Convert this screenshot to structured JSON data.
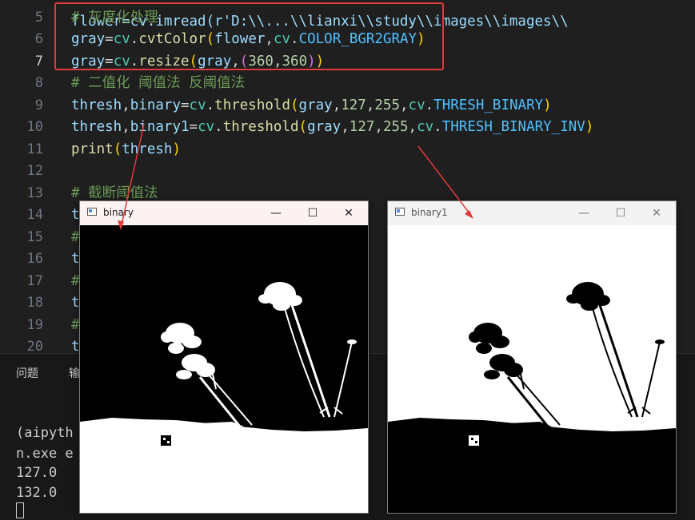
{
  "editor": {
    "lines": [
      {
        "n": "5",
        "active": false,
        "tokens": [
          {
            "t": "# 灰度化处理",
            "c": "comment"
          }
        ]
      },
      {
        "n": "6",
        "active": false,
        "tokens": [
          {
            "t": "gray",
            "c": "var"
          },
          {
            "t": "=",
            "c": "op"
          },
          {
            "t": "cv",
            "c": "mod"
          },
          {
            "t": ".",
            "c": "op"
          },
          {
            "t": "cvtColor",
            "c": "fn"
          },
          {
            "t": "(",
            "c": "p1"
          },
          {
            "t": "flower",
            "c": "var"
          },
          {
            "t": ",",
            "c": "op"
          },
          {
            "t": "cv",
            "c": "mod"
          },
          {
            "t": ".",
            "c": "op"
          },
          {
            "t": "COLOR_BGR2GRAY",
            "c": "const"
          },
          {
            "t": ")",
            "c": "p1"
          }
        ]
      },
      {
        "n": "7",
        "active": true,
        "tokens": [
          {
            "t": "gray",
            "c": "var"
          },
          {
            "t": "=",
            "c": "op"
          },
          {
            "t": "cv",
            "c": "mod"
          },
          {
            "t": ".",
            "c": "op"
          },
          {
            "t": "resize",
            "c": "fn"
          },
          {
            "t": "(",
            "c": "p1"
          },
          {
            "t": "gray",
            "c": "var"
          },
          {
            "t": ",",
            "c": "op"
          },
          {
            "t": "(",
            "c": "p2"
          },
          {
            "t": "360",
            "c": "num"
          },
          {
            "t": ",",
            "c": "op"
          },
          {
            "t": "360",
            "c": "num"
          },
          {
            "t": ")",
            "c": "p2"
          },
          {
            "t": ")",
            "c": "p1"
          }
        ]
      },
      {
        "n": "8",
        "active": false,
        "tokens": [
          {
            "t": "# 二值化 阈值法 反阈值法",
            "c": "comment"
          }
        ]
      },
      {
        "n": "9",
        "active": false,
        "tokens": [
          {
            "t": "thresh",
            "c": "var"
          },
          {
            "t": ",",
            "c": "op"
          },
          {
            "t": "binary",
            "c": "var"
          },
          {
            "t": "=",
            "c": "op"
          },
          {
            "t": "cv",
            "c": "mod"
          },
          {
            "t": ".",
            "c": "op"
          },
          {
            "t": "threshold",
            "c": "fn"
          },
          {
            "t": "(",
            "c": "p1"
          },
          {
            "t": "gray",
            "c": "var"
          },
          {
            "t": ",",
            "c": "op"
          },
          {
            "t": "127",
            "c": "num"
          },
          {
            "t": ",",
            "c": "op"
          },
          {
            "t": "255",
            "c": "num"
          },
          {
            "t": ",",
            "c": "op"
          },
          {
            "t": "cv",
            "c": "mod"
          },
          {
            "t": ".",
            "c": "op"
          },
          {
            "t": "THRESH_BINARY",
            "c": "const"
          },
          {
            "t": ")",
            "c": "p1"
          }
        ]
      },
      {
        "n": "10",
        "active": false,
        "tokens": [
          {
            "t": "thresh",
            "c": "var"
          },
          {
            "t": ",",
            "c": "op"
          },
          {
            "t": "binary1",
            "c": "var"
          },
          {
            "t": "=",
            "c": "op"
          },
          {
            "t": "cv",
            "c": "mod"
          },
          {
            "t": ".",
            "c": "op"
          },
          {
            "t": "threshold",
            "c": "fn"
          },
          {
            "t": "(",
            "c": "p1"
          },
          {
            "t": "gray",
            "c": "var"
          },
          {
            "t": ",",
            "c": "op"
          },
          {
            "t": "127",
            "c": "num"
          },
          {
            "t": ",",
            "c": "op"
          },
          {
            "t": "255",
            "c": "num"
          },
          {
            "t": ",",
            "c": "op"
          },
          {
            "t": "cv",
            "c": "mod"
          },
          {
            "t": ".",
            "c": "op"
          },
          {
            "t": "THRESH_BINARY_INV",
            "c": "const"
          },
          {
            "t": ")",
            "c": "p1"
          }
        ]
      },
      {
        "n": "11",
        "active": false,
        "tokens": [
          {
            "t": "print",
            "c": "fn"
          },
          {
            "t": "(",
            "c": "p1"
          },
          {
            "t": "thresh",
            "c": "var"
          },
          {
            "t": ")",
            "c": "p1"
          }
        ]
      },
      {
        "n": "12",
        "active": false,
        "tokens": []
      },
      {
        "n": "13",
        "active": false,
        "tokens": [
          {
            "t": "# 截断阈值法",
            "c": "comment"
          }
        ]
      },
      {
        "n": "14",
        "active": false,
        "tokens": [
          {
            "t": "t",
            "c": "var"
          }
        ]
      },
      {
        "n": "15",
        "active": false,
        "tokens": [
          {
            "t": "#",
            "c": "comment"
          }
        ]
      },
      {
        "n": "16",
        "active": false,
        "tokens": [
          {
            "t": "t",
            "c": "var"
          }
        ]
      },
      {
        "n": "17",
        "active": false,
        "tokens": [
          {
            "t": "#",
            "c": "comment"
          }
        ]
      },
      {
        "n": "18",
        "active": false,
        "tokens": [
          {
            "t": "t",
            "c": "var"
          }
        ]
      },
      {
        "n": "19",
        "active": false,
        "tokens": [
          {
            "t": "#",
            "c": "comment"
          }
        ]
      },
      {
        "n": "20",
        "active": false,
        "tokens": [
          {
            "t": "t",
            "c": "var"
          }
        ]
      }
    ],
    "top_line": "flower=cv.imread(r'D:\\\\...\\\\lianxi\\\\study\\\\images\\\\images\\\\"
  },
  "panel": {
    "tab_problems": "问题",
    "tab_output": "输",
    "terminal": [
      "(aipyth",
      "n.exe e",
      "127.0",
      "132.0"
    ]
  },
  "windows": {
    "binary": {
      "title": "binary"
    },
    "binary1": {
      "title": "binary1"
    }
  },
  "colors": {
    "accent_box": "#e03a3a",
    "arrow": "#e03a3a"
  }
}
